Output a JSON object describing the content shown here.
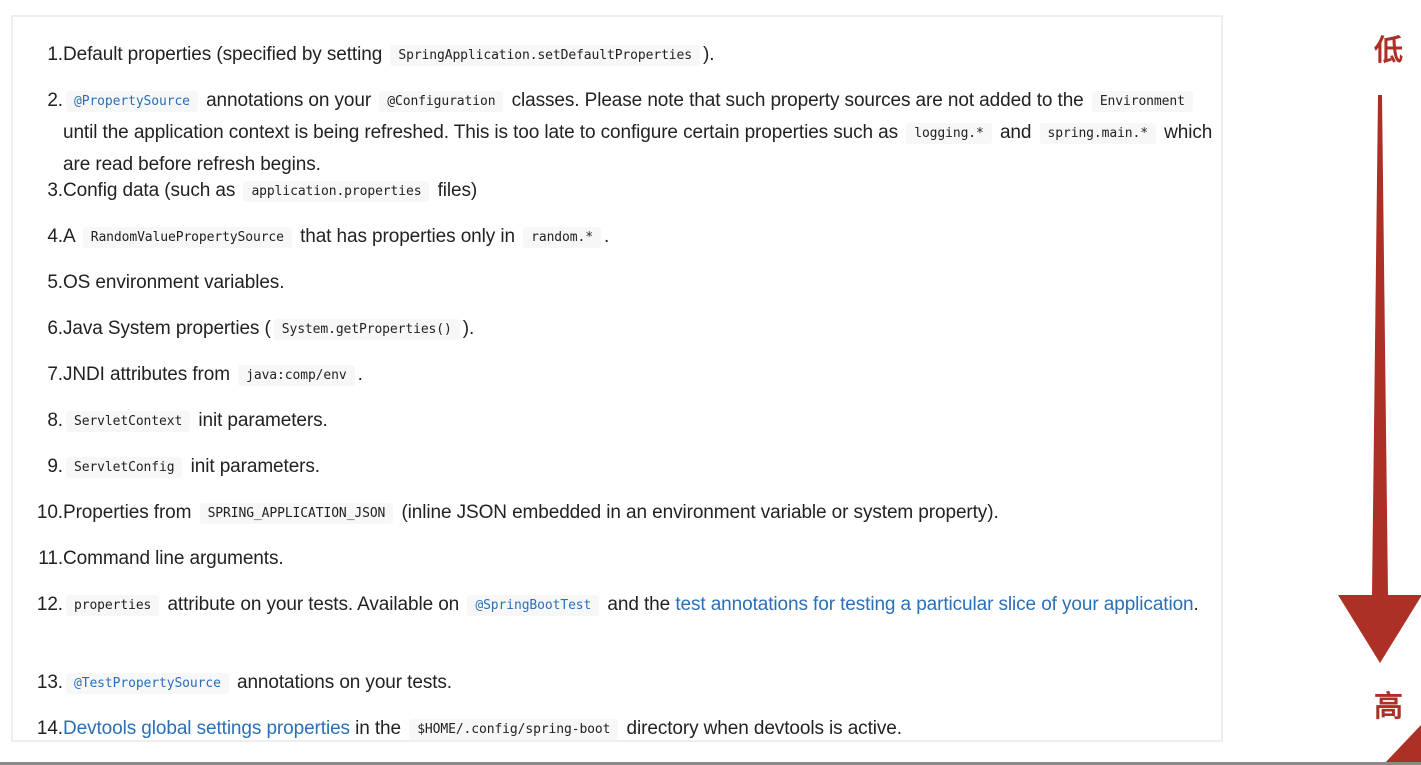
{
  "items": [
    {
      "num": "1.",
      "parts": [
        {
          "t": "text",
          "v": "Default properties (specified by setting "
        },
        {
          "t": "code",
          "v": "SpringApplication.setDefaultProperties"
        },
        {
          "t": "text",
          "v": ")."
        }
      ]
    },
    {
      "num": "2.",
      "parts": [
        {
          "t": "code-blue",
          "v": "@PropertySource"
        },
        {
          "t": "text",
          "v": " annotations on your "
        },
        {
          "t": "code",
          "v": "@Configuration"
        },
        {
          "t": "text",
          "v": " classes. Please note that such property sources are not added to the "
        },
        {
          "t": "code",
          "v": "Environment"
        },
        {
          "t": "text",
          "v": " until the application context is being refreshed. This is too late to configure certain properties such as "
        },
        {
          "t": "code",
          "v": "logging.*"
        },
        {
          "t": "text",
          "v": " and "
        },
        {
          "t": "code",
          "v": "spring.main.*"
        },
        {
          "t": "text",
          "v": " which are read before refresh begins."
        }
      ]
    },
    {
      "num": "3.",
      "parts": [
        {
          "t": "text",
          "v": "Config data (such as "
        },
        {
          "t": "code",
          "v": "application.properties"
        },
        {
          "t": "text",
          "v": " files)"
        }
      ]
    },
    {
      "num": "4.",
      "parts": [
        {
          "t": "text",
          "v": "A "
        },
        {
          "t": "code",
          "v": "RandomValuePropertySource"
        },
        {
          "t": "text",
          "v": " that has properties only in "
        },
        {
          "t": "code",
          "v": "random.*"
        },
        {
          "t": "text",
          "v": "."
        }
      ]
    },
    {
      "num": "5.",
      "parts": [
        {
          "t": "text",
          "v": "OS environment variables."
        }
      ]
    },
    {
      "num": "6.",
      "parts": [
        {
          "t": "text",
          "v": "Java System properties ("
        },
        {
          "t": "code",
          "v": "System.getProperties()"
        },
        {
          "t": "text",
          "v": ")."
        }
      ]
    },
    {
      "num": "7.",
      "parts": [
        {
          "t": "text",
          "v": "JNDI attributes from "
        },
        {
          "t": "code",
          "v": "java:comp/env"
        },
        {
          "t": "text",
          "v": "."
        }
      ]
    },
    {
      "num": "8.",
      "parts": [
        {
          "t": "code",
          "v": "ServletContext"
        },
        {
          "t": "text",
          "v": " init parameters."
        }
      ]
    },
    {
      "num": "9.",
      "parts": [
        {
          "t": "code",
          "v": "ServletConfig"
        },
        {
          "t": "text",
          "v": " init parameters."
        }
      ]
    },
    {
      "num": "10.",
      "parts": [
        {
          "t": "text",
          "v": "Properties from "
        },
        {
          "t": "code",
          "v": "SPRING_APPLICATION_JSON"
        },
        {
          "t": "text",
          "v": " (inline JSON embedded in an environment variable or system property)."
        }
      ]
    },
    {
      "num": "11.",
      "parts": [
        {
          "t": "text",
          "v": "Command line arguments."
        }
      ]
    },
    {
      "num": "12.",
      "parts": [
        {
          "t": "code",
          "v": "properties"
        },
        {
          "t": "text",
          "v": " attribute on your tests. Available on "
        },
        {
          "t": "code-blue",
          "v": "@SpringBootTest"
        },
        {
          "t": "text",
          "v": " and the "
        },
        {
          "t": "link",
          "v": "test annotations for testing a particular slice of your application"
        },
        {
          "t": "text",
          "v": "."
        }
      ]
    },
    {
      "num": "13.",
      "parts": [
        {
          "t": "code-blue",
          "v": "@TestPropertySource"
        },
        {
          "t": "text",
          "v": " annotations on your tests."
        }
      ]
    },
    {
      "num": "14.",
      "parts": [
        {
          "t": "link",
          "v": "Devtools global settings properties"
        },
        {
          "t": "text",
          "v": " in the "
        },
        {
          "t": "code",
          "v": "$HOME/.config/spring-boot"
        },
        {
          "t": "text",
          "v": " directory when devtools is active."
        }
      ]
    }
  ],
  "annotation": {
    "low_label": "低",
    "high_label": "高",
    "arrow_color": "#ad3027"
  }
}
